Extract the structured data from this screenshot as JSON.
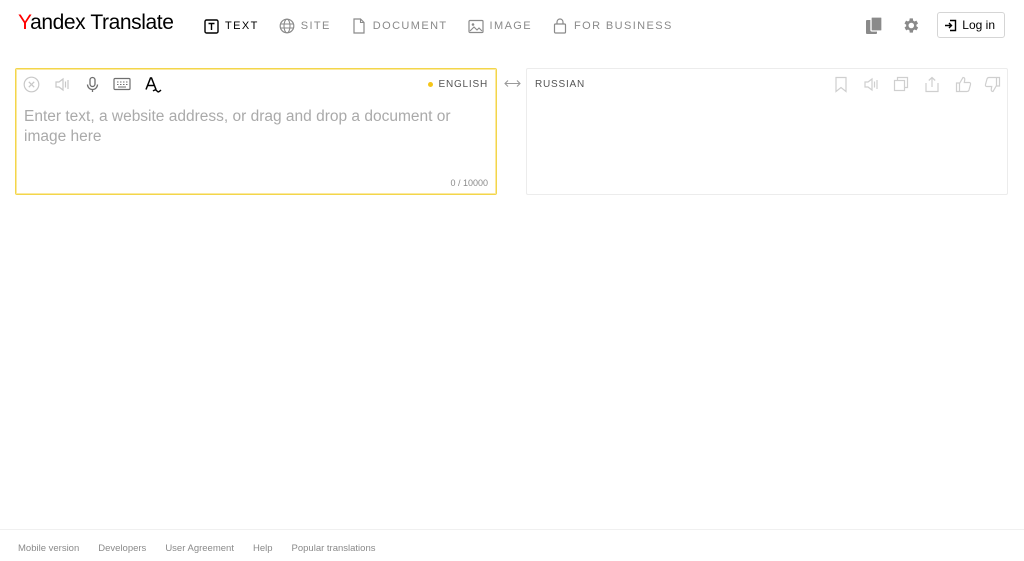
{
  "logo": {
    "first_letter": "Y",
    "rest": "andex",
    "product": " Translate"
  },
  "nav": {
    "items": [
      {
        "label": "TEXT",
        "icon": "text-icon",
        "active": true
      },
      {
        "label": "SITE",
        "icon": "globe-icon"
      },
      {
        "label": "DOCUMENT",
        "icon": "document-icon"
      },
      {
        "label": "IMAGE",
        "icon": "image-icon"
      },
      {
        "label": "FOR BUSINESS",
        "icon": "lock-bag-icon"
      }
    ]
  },
  "header_right": {
    "collections_icon": "collections-icon",
    "settings_icon": "gear-icon",
    "login_label": "Log in",
    "login_icon": "login-icon"
  },
  "source": {
    "language": "ENGLISH",
    "placeholder": "Enter text, a website address, or drag and drop a document or image here",
    "value": "",
    "counter": "0 / 10000",
    "tools": [
      "clear-icon",
      "speaker-icon",
      "microphone-icon",
      "keyboard-icon",
      "spellcheck-icon"
    ]
  },
  "target": {
    "language": "RUSSIAN",
    "tools": [
      "bookmark-icon",
      "speaker-icon",
      "copy-icon",
      "share-icon",
      "thumbs-up-icon",
      "thumbs-down-icon"
    ]
  },
  "footer": {
    "links": [
      "Mobile version",
      "Developers",
      "User Agreement",
      "Help",
      "Popular translations"
    ]
  },
  "colors": {
    "accent_yellow": "#f5c518",
    "brand_red": "#ff0000",
    "muted_text": "#8a8a8a"
  }
}
